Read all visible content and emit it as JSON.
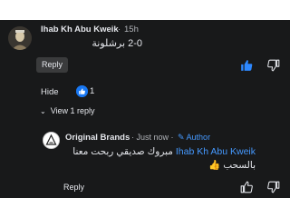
{
  "comment": {
    "author": "Ihab Kh Abu Kweik",
    "separator": "·",
    "timestamp": "15h",
    "text": "2-0 برشلونة",
    "reply_label": "Reply"
  },
  "reactions": {
    "hide_label": "Hide",
    "count": "1"
  },
  "replies_toggle": {
    "chevron": "⌄",
    "label": "View 1 reply"
  },
  "reply": {
    "author": "Original Brands",
    "meta": "· Just now ·",
    "author_badge": "✎ Author",
    "mention": "Ihab Kh Abu Kweik",
    "text": "مبروك صديقي ربحت معنا بالسحب",
    "emoji": "👍",
    "reply_label": "Reply"
  },
  "colors": {
    "background": "#18191a",
    "accent": "#1877f2",
    "link": "#4599ff",
    "text": "#e4e6eb",
    "muted": "#b0b3b8"
  },
  "icons": {
    "like": "thumbs-up-icon",
    "dislike": "thumbs-down-icon",
    "chevron": "chevron-down-icon",
    "pencil": "pencil-icon"
  }
}
